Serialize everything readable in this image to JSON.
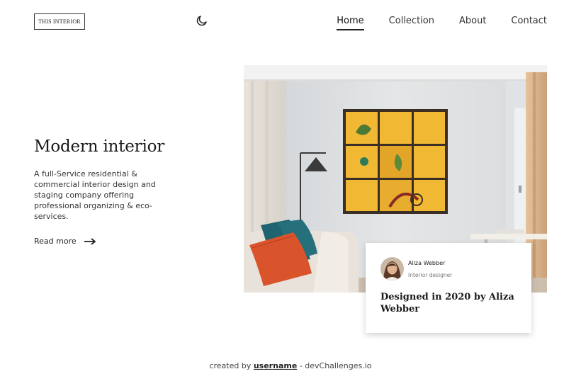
{
  "header": {
    "logo_text": "THIS INTERIOR",
    "theme_icon": "moon-icon",
    "nav": [
      {
        "label": "Home",
        "active": true
      },
      {
        "label": "Collection",
        "active": false
      },
      {
        "label": "About",
        "active": false
      },
      {
        "label": "Contact",
        "active": false
      }
    ]
  },
  "hero": {
    "title": "Modern interior",
    "description": "A full-Service residential & commercial interior design and staging company offering professional organizing & eco-services.",
    "read_more_label": "Read more",
    "read_more_icon": "arrow-right-icon"
  },
  "credit_card": {
    "author_name": "Aliza Webber",
    "author_role": "Interior designer",
    "title": "Designed in 2020 by Aliza Webber"
  },
  "footer": {
    "prefix": "created by",
    "username": "username",
    "suffix": "- devChallenges.io"
  },
  "colors": {
    "accent_orange": "#d9532b",
    "accent_teal": "#1f6470",
    "art_yellow": "#f0b833"
  }
}
